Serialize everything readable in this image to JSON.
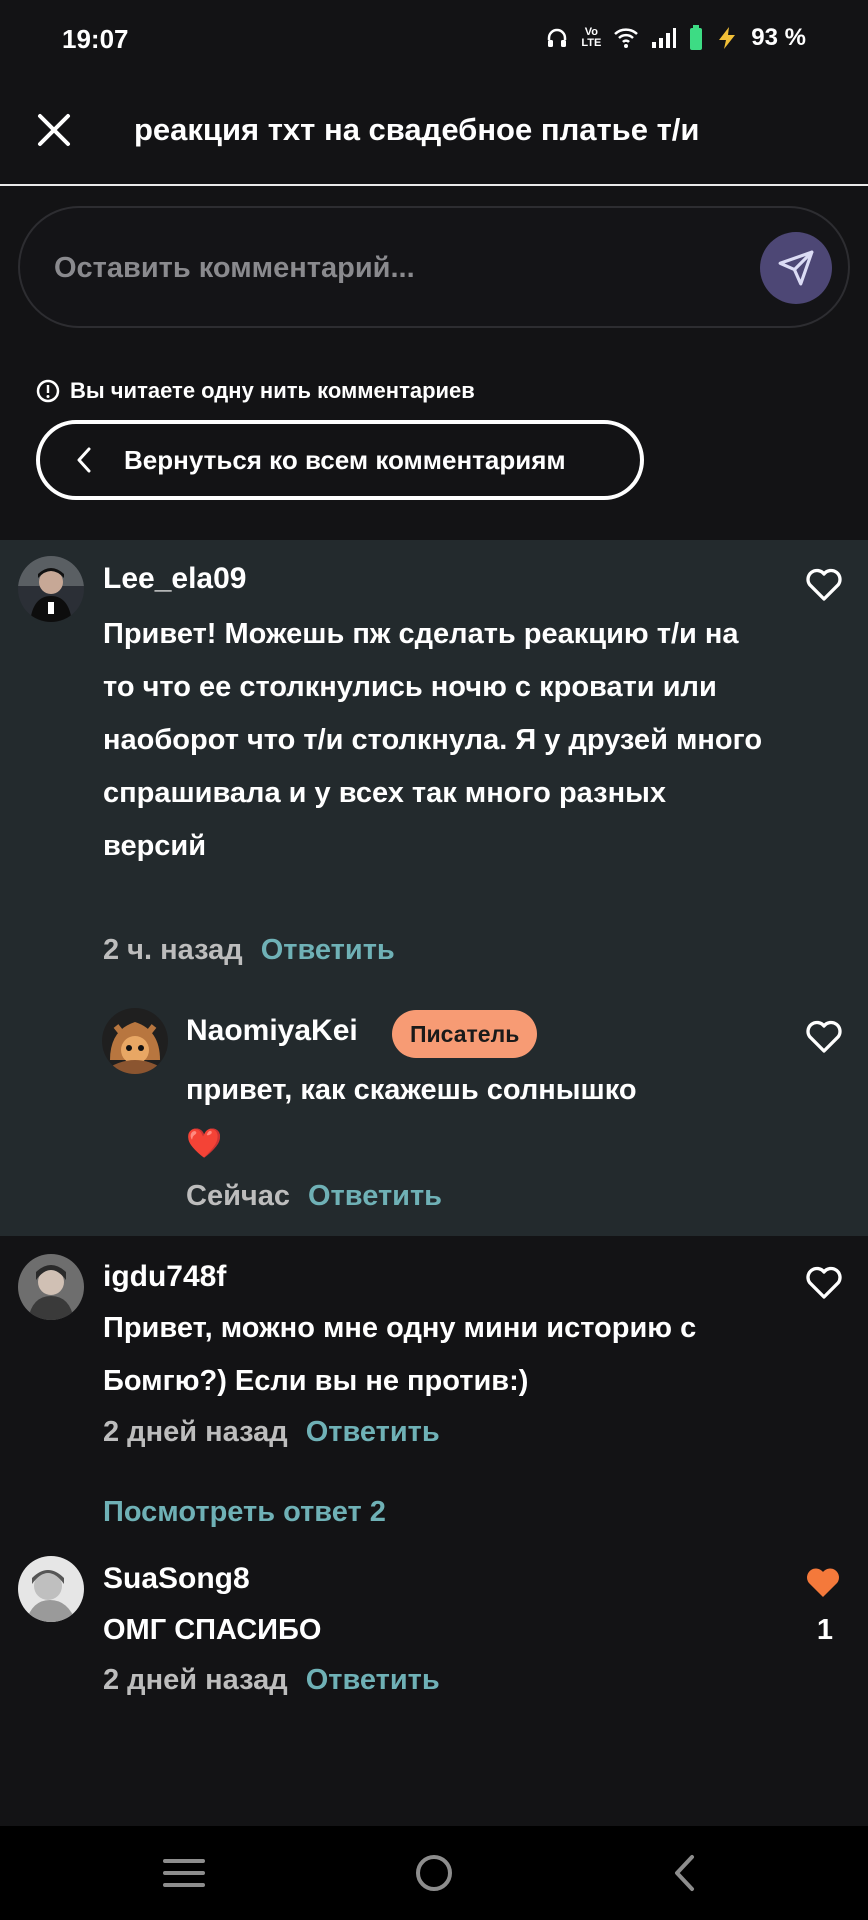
{
  "status_bar": {
    "time": "19:07",
    "volte_top": "Vo",
    "volte_bottom": "LTE",
    "battery_percent": "93 %"
  },
  "header": {
    "title": "реакция тхт на свадебное платье т/и"
  },
  "comment_input": {
    "placeholder": "Оставить комментарий..."
  },
  "thread_notice": {
    "text": "Вы читаете одну нить комментариев",
    "back_label": "Вернуться ко всем комментариям"
  },
  "comments": [
    {
      "username": "Lee_ela09",
      "text": "Привет! Можешь пж сделать реакцию т/и на то что ее столкнулись ночю с кровати или наоборот  что т/и столкнула. Я у друзей много спрашивала и у всех так много разных версий",
      "time": "2 ч. назад",
      "reply_label": "Ответить",
      "liked": false,
      "reply": {
        "username": "NaomiyaKei",
        "badge": "Писатель",
        "text": "привет, как скажешь солнышко",
        "emoji": "❤️",
        "time": "Сейчас",
        "reply_label": "Ответить",
        "liked": false
      }
    },
    {
      "username": "igdu748f",
      "text": "Привет, можно мне одну мини историю с Бомгю?) Если вы не против:)",
      "time": "2 дней назад",
      "reply_label": "Ответить",
      "liked": false,
      "view_replies": "Посмотреть ответ 2"
    },
    {
      "username": "SuaSong8",
      "text": "ОМГ СПАСИБО",
      "time": "2 дней назад",
      "reply_label": "Ответить",
      "liked": true,
      "like_count": "1"
    }
  ],
  "colors": {
    "background": "#131315",
    "thread_highlight": "#232a2d",
    "accent_reply": "#6fb1b6",
    "badge": "#f79b74",
    "liked_heart": "#f4793b",
    "send_button": "#4d4775"
  },
  "icons": [
    "close-icon",
    "send-icon",
    "info-icon",
    "chevron-left-icon",
    "heart-icon",
    "heart-filled-icon",
    "menu-icon",
    "home-icon",
    "back-icon"
  ]
}
